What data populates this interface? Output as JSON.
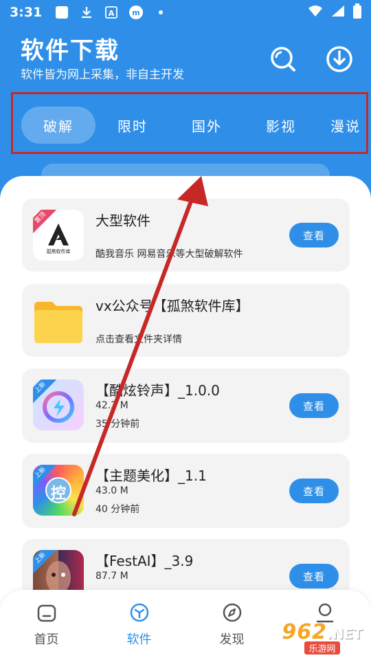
{
  "status_bar": {
    "time": "3:31",
    "icons": [
      "gallery-icon",
      "download-icon",
      "font-app-icon",
      "m-app-icon",
      "dot-icon"
    ],
    "right_icons": [
      "wifi-icon",
      "signal-icon",
      "battery-icon"
    ]
  },
  "header": {
    "title": "软件下载",
    "subtitle": "软件皆为网上采集，非自主开发",
    "icons": [
      "search-icon",
      "download-icon"
    ]
  },
  "tabs": [
    {
      "label": "破解",
      "active": true
    },
    {
      "label": "限时",
      "active": false
    },
    {
      "label": "国外",
      "active": false
    },
    {
      "label": "影视",
      "active": false
    },
    {
      "label": "漫说",
      "active": false
    }
  ],
  "cards": [
    {
      "title": "大型软件",
      "meta1": "",
      "meta2": "酷我音乐 网易音乐等大型破解软件",
      "button": "查看",
      "tag": "置顶"
    },
    {
      "title": "vx公众号【孤煞软件库】",
      "meta1": "",
      "meta2": "点击查看文件夹详情",
      "button": "",
      "tag": ""
    },
    {
      "title": "【酷炫铃声】_1.0.0",
      "meta1": "42.2 M",
      "meta2": "35 分钟前",
      "button": "查看",
      "tag": "上新"
    },
    {
      "title": "【主题美化】_1.1",
      "meta1": "43.0 M",
      "meta2": "40 分钟前",
      "button": "查看",
      "tag": "上新"
    },
    {
      "title": "【FestAI】_3.9",
      "meta1": "87.7 M",
      "meta2": "",
      "button": "查看",
      "tag": "上新"
    }
  ],
  "icon_texts": {
    "card1_logo_text": "孤煞软件库",
    "card4_center": "控"
  },
  "bottom_nav": [
    {
      "label": "首页",
      "icon": "home-icon",
      "active": false
    },
    {
      "label": "软件",
      "icon": "cube-icon",
      "active": true
    },
    {
      "label": "发现",
      "icon": "compass-icon",
      "active": false
    },
    {
      "label": "我的",
      "icon": "user-icon",
      "active": false
    }
  ],
  "watermark": {
    "number": "962",
    "suffix": ".NET",
    "sub": "乐游网"
  },
  "colors": {
    "primary": "#2f8fe8",
    "highlight_border": "#c62828",
    "arrow": "#c62828"
  }
}
